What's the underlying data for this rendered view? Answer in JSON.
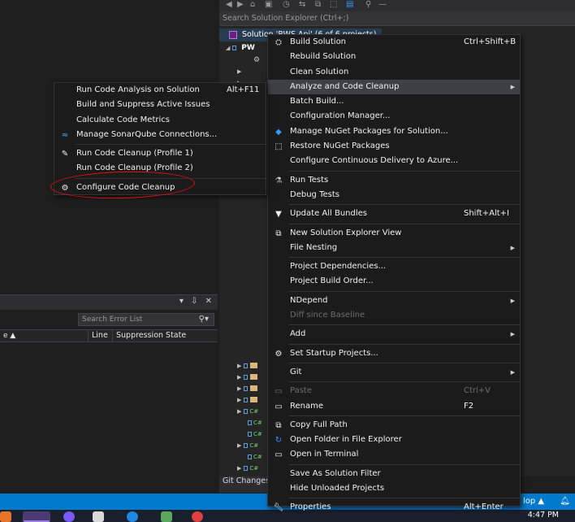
{
  "solution_explorer": {
    "search_placeholder": "Search Solution Explorer (Ctrl+;)",
    "solution_label": "Solution 'RWS.Api' (6 of 6 projects)",
    "project_label": "PW",
    "git_changes_tab": "Git Changes"
  },
  "error_list": {
    "search_placeholder": "Search Error List",
    "columns": {
      "sort_indicator": "e ▲",
      "line": "Line",
      "suppression": "Suppression State"
    }
  },
  "status_bar": {
    "right_text": "lop ▲"
  },
  "taskbar": {
    "clock": "4:47 PM"
  },
  "main_menu": [
    {
      "label": "Build Solution",
      "shortcut": "Ctrl+Shift+B",
      "icon": "build-icon"
    },
    {
      "label": "Rebuild Solution",
      "shortcut": "",
      "icon": ""
    },
    {
      "label": "Clean Solution",
      "shortcut": "",
      "icon": ""
    },
    {
      "label": "Analyze and Code Cleanup",
      "shortcut": "",
      "icon": "",
      "submenu": true
    },
    {
      "label": "Batch Build...",
      "shortcut": "",
      "icon": ""
    },
    {
      "label": "Configuration Manager...",
      "shortcut": "",
      "icon": ""
    },
    {
      "label": "Manage NuGet Packages for Solution...",
      "shortcut": "",
      "icon": "nuget-icon"
    },
    {
      "label": "Restore NuGet Packages",
      "shortcut": "",
      "icon": "restore-icon"
    },
    {
      "label": "Configure Continuous Delivery to Azure...",
      "shortcut": "",
      "icon": ""
    },
    {
      "label": "Run Tests",
      "shortcut": "",
      "icon": "run-tests-icon"
    },
    {
      "label": "Debug Tests",
      "shortcut": "",
      "icon": ""
    },
    {
      "label": "Update All Bundles",
      "shortcut": "Shift+Alt+I",
      "icon": "filter-icon"
    },
    {
      "label": "New Solution Explorer View",
      "shortcut": "",
      "icon": "new-view-icon"
    },
    {
      "label": "File Nesting",
      "shortcut": "",
      "icon": "",
      "submenu": true
    },
    {
      "label": "Project Dependencies...",
      "shortcut": "",
      "icon": ""
    },
    {
      "label": "Project Build Order...",
      "shortcut": "",
      "icon": ""
    },
    {
      "label": "NDepend",
      "shortcut": "",
      "icon": "",
      "submenu": true
    },
    {
      "label": "Diff since Baseline",
      "shortcut": "",
      "icon": ""
    },
    {
      "label": "Add",
      "shortcut": "",
      "icon": "",
      "submenu": true
    },
    {
      "label": "Set Startup Projects...",
      "shortcut": "",
      "icon": "gear-icon"
    },
    {
      "label": "Git",
      "shortcut": "",
      "icon": "",
      "submenu": true
    },
    {
      "label": "Paste",
      "shortcut": "Ctrl+V",
      "icon": "paste-icon"
    },
    {
      "label": "Rename",
      "shortcut": "F2",
      "icon": "rename-icon"
    },
    {
      "label": "Copy Full Path",
      "shortcut": "",
      "icon": "copy-icon"
    },
    {
      "label": "Open Folder in File Explorer",
      "shortcut": "",
      "icon": "refresh-icon"
    },
    {
      "label": "Open in Terminal",
      "shortcut": "",
      "icon": "terminal-icon"
    },
    {
      "label": "Save As Solution Filter",
      "shortcut": "",
      "icon": ""
    },
    {
      "label": "Hide Unloaded Projects",
      "shortcut": "",
      "icon": ""
    },
    {
      "label": "Properties",
      "shortcut": "Alt+Enter",
      "icon": "wrench-icon"
    }
  ],
  "sub_menu": [
    {
      "label": "Run Code Analysis on Solution",
      "shortcut": "Alt+F11",
      "icon": ""
    },
    {
      "label": "Build and Suppress Active Issues",
      "shortcut": "",
      "icon": ""
    },
    {
      "label": "Calculate Code Metrics",
      "shortcut": "",
      "icon": ""
    },
    {
      "label": "Manage SonarQube Connections...",
      "shortcut": "",
      "icon": "sonarqube-icon"
    },
    {
      "label": "Run Code Cleanup (Profile 1)",
      "shortcut": "",
      "icon": "broom-icon"
    },
    {
      "label": "Run Code Cleanup (Profile 2)",
      "shortcut": "",
      "icon": ""
    },
    {
      "label": "Configure Code Cleanup",
      "shortcut": "",
      "icon": "gear-icon"
    }
  ],
  "colors": {
    "accent": "#007acc",
    "menu_bg": "#1b1b1c",
    "menu_highlight": "#3f3f46",
    "annotation": "#e01010"
  }
}
